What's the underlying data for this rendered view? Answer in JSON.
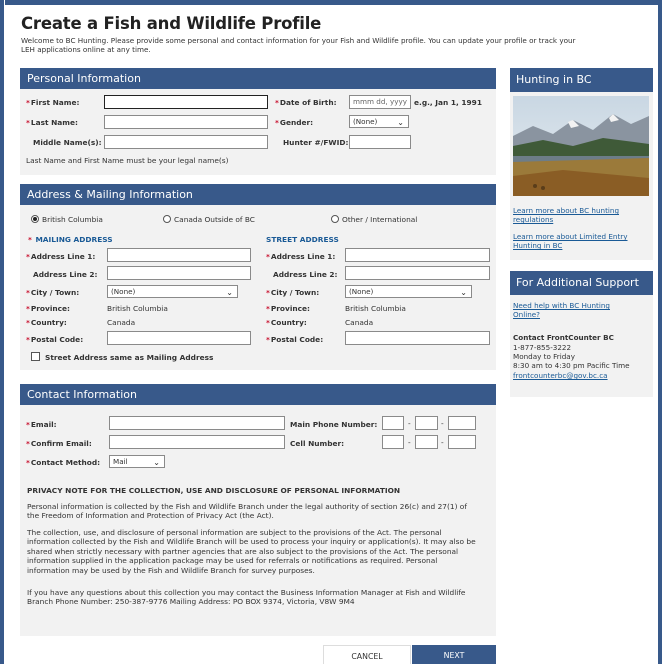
{
  "page": {
    "title": "Create a Fish and Wildlife Profile",
    "intro": "Welcome to BC Hunting. Please provide some personal and contact information for your Fish and Wildlife profile. You can update your profile or track your LEH applications online at any time."
  },
  "personal": {
    "header": "Personal Information",
    "first_name_label": "First Name:",
    "last_name_label": "Last Name:",
    "middle_name_label": "Middle Name(s):",
    "dob_label": "Date of Birth:",
    "dob_placeholder": "mmm dd, yyyy",
    "dob_hint": "e.g., Jan 1, 1991",
    "gender_label": "Gender:",
    "gender_value": "(None)",
    "hunter_label": "Hunter #/FWID:",
    "legal_note": "Last Name and First Name must be your legal name(s)"
  },
  "address": {
    "header": "Address & Mailing Information",
    "radio_bc": "British Columbia",
    "radio_canada": "Canada Outside of BC",
    "radio_other": "Other / International",
    "mailing_heading": "MAILING ADDRESS",
    "street_heading": "STREET ADDRESS",
    "line1_label": "Address Line 1:",
    "line2_label": "Address Line 2:",
    "city_label": "City / Town:",
    "city_value": "(None)",
    "province_label": "Province:",
    "province_value": "British Columbia",
    "country_label": "Country:",
    "country_value": "Canada",
    "postal_label": "Postal Code:",
    "same_as_label": "Street Address same as Mailing Address"
  },
  "contact": {
    "header": "Contact Information",
    "email_label": "Email:",
    "confirm_email_label": "Confirm Email:",
    "method_label": "Contact Method:",
    "method_value": "Mail",
    "main_phone_label": "Main Phone Number:",
    "cell_label": "Cell Number:",
    "phone_sep": "-",
    "privacy_title": "PRIVACY NOTE FOR THE COLLECTION, USE AND DISCLOSURE OF PERSONAL INFORMATION",
    "privacy_p1": "Personal information is collected by the Fish and Wildlife Branch under the legal authority of section 26(c) and 27(1) of the Freedom of Information and Protection of Privacy Act (the Act).",
    "privacy_p2": "The collection, use, and disclosure of personal information are subject to the provisions of the Act. The personal information collected by the Fish and Wildlife Branch will be used to process your inquiry or application(s). It may also be shared when strictly necessary with partner agencies that are also subject to the provisions of the Act. The personal information supplied in the application package may be used for referrals or notifications as required. Personal information may be used by the Fish and Wildlife Branch for survey purposes.",
    "privacy_p3": "If you have any questions about this collection you may contact the Business Information Manager at Fish and Wildlife Branch Phone Number: 250-387-9776 Mailing Address: PO BOX 9374, Victoria, V8W 9M4"
  },
  "buttons": {
    "cancel": "CANCEL",
    "next": "NEXT"
  },
  "sidebar": {
    "hunting_header": "Hunting in BC",
    "link_regulations": "Learn more about BC hunting regulations",
    "link_leh": "Learn more about Limited Entry Hunting in BC",
    "support_header": "For Additional Support",
    "link_help": "Need help with BC Hunting Online?",
    "contact_title": "Contact FrontCounter BC",
    "contact_phone": "1-877-855-3222",
    "contact_days": "Monday to Friday",
    "contact_hours": "8:30 am to 4:30 pm Pacific Time",
    "contact_email": "frontcounterbc@gov.bc.ca"
  },
  "colors": {
    "brand": "#38598a",
    "required": "#c8102e",
    "link": "#1a5a96"
  }
}
